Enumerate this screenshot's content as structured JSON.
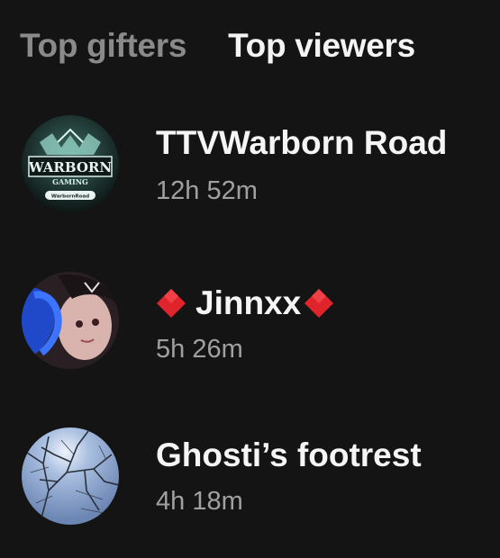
{
  "tabs": {
    "top_gifters": "Top gifters",
    "top_viewers": "Top viewers"
  },
  "viewers": [
    {
      "name": "TTVWarborn Road",
      "duration": "12h 52m",
      "avatar_icon": "warborn-gaming-logo",
      "logo_text": "WARBORN",
      "logo_sub": "GAMING",
      "logo_tag": "WarbornRoad"
    },
    {
      "name": "Jinnxx",
      "duration": "5h 26m",
      "avatar_icon": "anime-character-avatar",
      "prefix_icon": "red-diamond",
      "suffix_icon": "red-diamond"
    },
    {
      "name": "Ghosti’s footrest",
      "duration": "4h 18m",
      "avatar_icon": "tree-branches-sky-avatar"
    }
  ],
  "colors": {
    "background": "#141414",
    "diamond": "#e0242c",
    "muted_text": "#a0a0a0"
  }
}
